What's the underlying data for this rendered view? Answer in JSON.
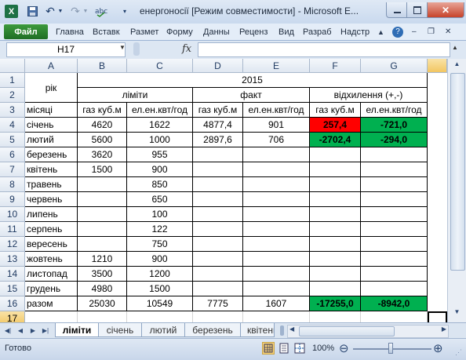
{
  "window": {
    "title": "енергоносії  [Режим совместимости]  -  Microsoft E..."
  },
  "quick_access": {
    "excel_icon": "X",
    "save_icon": "save-icon",
    "undo_icon": "↶",
    "redo_icon": "↷"
  },
  "ribbon": {
    "file_label": "Файл",
    "tabs": [
      "Главна",
      "Вставк",
      "Размет",
      "Форму",
      "Данны",
      "Реценз",
      "Вид",
      "Разраб",
      "Надстр"
    ]
  },
  "formula_bar": {
    "cell_ref": "H17",
    "fx_label": "fx",
    "formula": ""
  },
  "columns": [
    "A",
    "B",
    "C",
    "D",
    "E",
    "F",
    "G"
  ],
  "rows": [
    "1",
    "2",
    "3",
    "4",
    "5",
    "6",
    "7",
    "8",
    "9",
    "10",
    "11",
    "12",
    "13",
    "14",
    "15",
    "16",
    "17"
  ],
  "sheet": {
    "year_label": "рік",
    "year": "2015",
    "limits": "ліміти",
    "fact": "факт",
    "deviation": "відхилення (+,-)",
    "months_label": "місяці",
    "gas_label": "газ куб.м",
    "elec_label": "ел.ен.квт/год",
    "months": [
      {
        "month": "січень",
        "lim_gas": "4620",
        "lim_el": "1622",
        "fact_gas": "4877,4",
        "fact_el": "901",
        "dev_gas": "257,4",
        "dev_el": "-721,0"
      },
      {
        "month": "лютий",
        "lim_gas": "5600",
        "lim_el": "1000",
        "fact_gas": "2897,6",
        "fact_el": "706",
        "dev_gas": "-2702,4",
        "dev_el": "-294,0"
      },
      {
        "month": "березень",
        "lim_gas": "3620",
        "lim_el": "955"
      },
      {
        "month": "квітень",
        "lim_gas": "1500",
        "lim_el": "900"
      },
      {
        "month": "травень",
        "lim_el": "850"
      },
      {
        "month": "червень",
        "lim_el": "650"
      },
      {
        "month": "липень",
        "lim_el": "100"
      },
      {
        "month": "серпень",
        "lim_el": "122"
      },
      {
        "month": "вересень",
        "lim_el": "750"
      },
      {
        "month": "жовтень",
        "lim_gas": "1210",
        "lim_el": "900"
      },
      {
        "month": "листопад",
        "lim_gas": "3500",
        "lim_el": "1200"
      },
      {
        "month": "грудень",
        "lim_gas": "4980",
        "lim_el": "1500"
      }
    ],
    "total": {
      "label": "разом",
      "lim_gas": "25030",
      "lim_el": "10549",
      "fact_gas": "7775",
      "fact_el": "1607",
      "dev_gas": "-17255,0",
      "dev_el": "-8942,0"
    }
  },
  "sheet_tabs": [
    "ліміти",
    "січень",
    "лютий",
    "березень",
    "квітень"
  ],
  "active_sheet": "ліміти",
  "status": {
    "ready": "Готово",
    "zoom": "100%",
    "zoom_out": "⊖",
    "zoom_in": "⊕"
  },
  "colors": {
    "positive_deviation": "#ff0000",
    "negative_deviation": "#00b050",
    "file_tab": "#2a7d2e"
  }
}
